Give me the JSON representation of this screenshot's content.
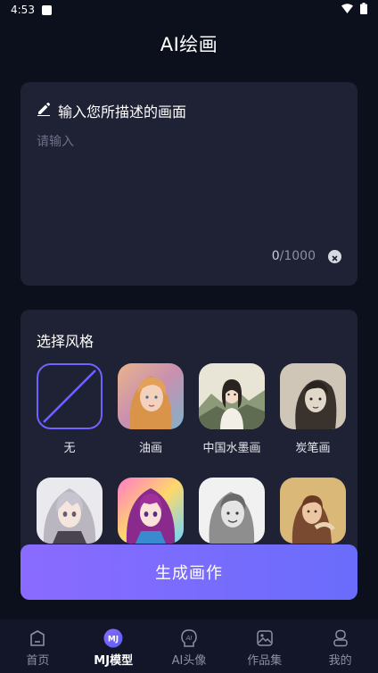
{
  "status_bar": {
    "time": "4:53"
  },
  "app": {
    "title": "AI绘画"
  },
  "prompt": {
    "heading": "输入您所描述的画面",
    "placeholder": "请输入",
    "count_current": "0",
    "count_max": "/1000"
  },
  "style": {
    "heading": "选择风格",
    "items": [
      {
        "label": "无",
        "icon": "none-slash"
      },
      {
        "label": "油画",
        "icon": "oil-painting-portrait"
      },
      {
        "label": "中国水墨画",
        "icon": "ink-painting-portrait"
      },
      {
        "label": "炭笔画",
        "icon": "charcoal-portrait"
      },
      {
        "label": "",
        "icon": "anime-portrait"
      },
      {
        "label": "",
        "icon": "colorful-anime-portrait"
      },
      {
        "label": "",
        "icon": "sketch-portrait"
      },
      {
        "label": "",
        "icon": "vintage-portrait"
      }
    ]
  },
  "generate_button": {
    "label": "生成画作"
  },
  "bottom_nav": {
    "items": [
      {
        "label": "首页",
        "icon": "home-icon"
      },
      {
        "label": "MJ模型",
        "icon": "mj-icon",
        "badge": "MJ"
      },
      {
        "label": "AI头像",
        "icon": "ai-avatar-icon"
      },
      {
        "label": "作品集",
        "icon": "gallery-icon"
      },
      {
        "label": "我的",
        "icon": "profile-icon"
      }
    ]
  },
  "colors": {
    "background": "#0c0f1c",
    "card": "#1f2234",
    "accent": "#6e63ff",
    "button_gradient_start": "#8a6bff",
    "button_gradient_end": "#6a6cfb"
  }
}
